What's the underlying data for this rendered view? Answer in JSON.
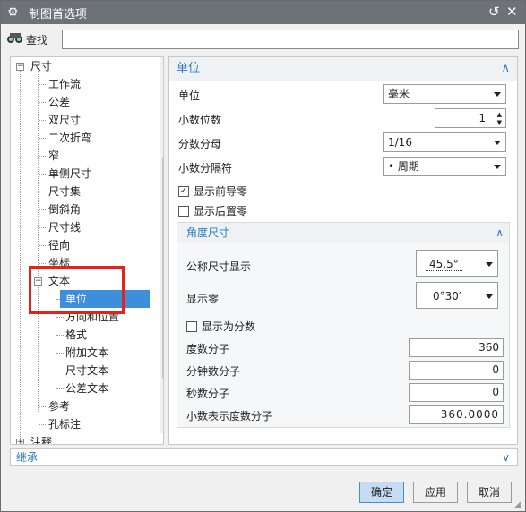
{
  "window": {
    "title": "制图首选项"
  },
  "search": {
    "label": "查找",
    "value": ""
  },
  "tree": {
    "items": [
      {
        "label": "尺寸"
      },
      {
        "label": "工作流"
      },
      {
        "label": "公差"
      },
      {
        "label": "双尺寸"
      },
      {
        "label": "二次折弯"
      },
      {
        "label": "窄"
      },
      {
        "label": "单侧尺寸"
      },
      {
        "label": "尺寸集"
      },
      {
        "label": "倒斜角"
      },
      {
        "label": "尺寸线"
      },
      {
        "label": "径向"
      },
      {
        "label": "坐标"
      },
      {
        "label": "文本"
      },
      {
        "label": "单位"
      },
      {
        "label": "方向和位置"
      },
      {
        "label": "格式"
      },
      {
        "label": "附加文本"
      },
      {
        "label": "尺寸文本"
      },
      {
        "label": "公差文本"
      },
      {
        "label": "参考"
      },
      {
        "label": "孔标注"
      },
      {
        "label": "注释"
      }
    ]
  },
  "panel": {
    "section_title": "单位",
    "unit_label": "单位",
    "unit_value": "毫米",
    "decimals_label": "小数位数",
    "decimals_value": "1",
    "frac_denom_label": "分数分母",
    "frac_denom_value": "1/16",
    "decimal_sep_label": "小数分隔符",
    "decimal_sep_value": "• 周期",
    "show_leading_zero_label": "显示前导零",
    "show_leading_zero_checked": true,
    "show_trailing_zero_label": "显示后置零",
    "show_trailing_zero_checked": false,
    "angle": {
      "title": "角度尺寸",
      "nominal_label": "公称尺寸显示",
      "nominal_value": "45.5°",
      "show_zero_label": "显示零",
      "show_zero_value": "0°30′",
      "as_fraction_label": "显示为分数",
      "as_fraction_checked": false,
      "degree_num_label": "度数分子",
      "degree_num_value": "360",
      "minute_num_label": "分钟数分子",
      "minute_num_value": "0",
      "second_num_label": "秒数分子",
      "second_num_value": "0",
      "decimal_num_label": "小数表示度数分子",
      "decimal_num_value": "360.0000"
    }
  },
  "inherit": {
    "label": "继承"
  },
  "buttons": {
    "ok": "确定",
    "apply": "应用",
    "cancel": "取消"
  },
  "colors": {
    "title_bar": "#6d7278",
    "accent": "#2c7cc1",
    "selection": "#3d8fd9",
    "highlight_box": "#e2231a"
  }
}
